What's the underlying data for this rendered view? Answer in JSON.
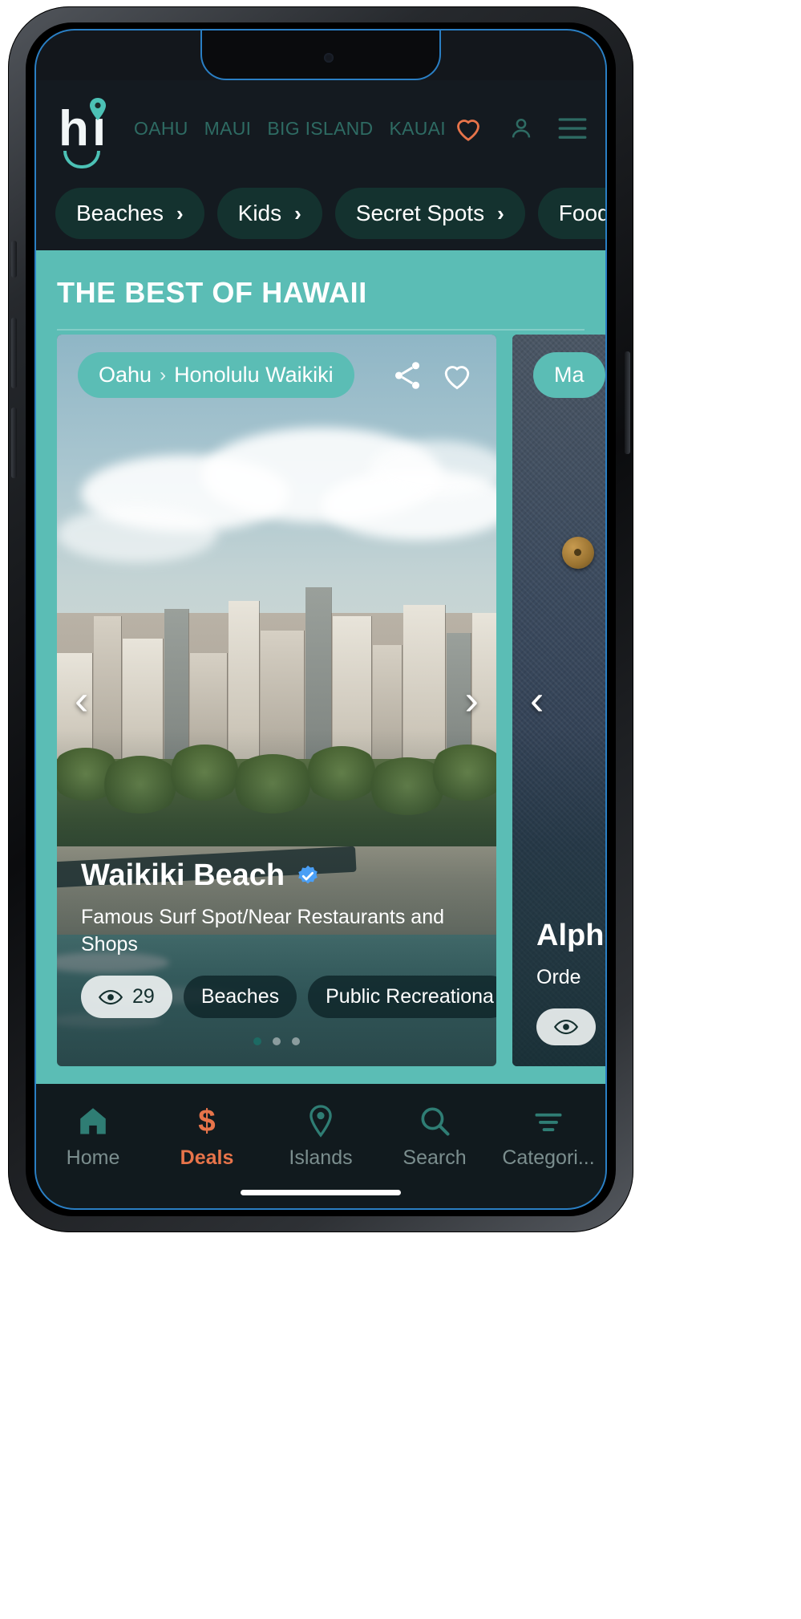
{
  "brand": {
    "logo_text_h": "h",
    "logo_text_i": "i",
    "pin_icon": "location-pin-icon",
    "accent_teal": "#5bbdb5",
    "accent_orange": "#e8744a",
    "header_bg": "#141a20"
  },
  "header": {
    "islands": [
      {
        "label": "OAHU"
      },
      {
        "label": "MAUI"
      },
      {
        "label": "BIG ISLAND"
      },
      {
        "label": "KAUAI"
      }
    ],
    "icons": [
      {
        "name": "heart-icon",
        "color": "#e8744a"
      },
      {
        "name": "user-icon",
        "color": "#2e6b63"
      },
      {
        "name": "hamburger-menu-icon",
        "color": "#2e6b63"
      }
    ]
  },
  "chips": [
    {
      "label": "Beaches",
      "arrow": "›"
    },
    {
      "label": "Kids",
      "arrow": "›"
    },
    {
      "label": "Secret Spots",
      "arrow": "›"
    },
    {
      "label": "Food",
      "arrow": "›"
    }
  ],
  "section": {
    "title": "THE BEST OF HAWAII"
  },
  "cards": [
    {
      "breadcrumb_island": "Oahu",
      "breadcrumb_sep": "›",
      "breadcrumb_place": "Honolulu Waikiki",
      "share_icon": "share-icon",
      "favorite_icon": "heart-outline-icon",
      "prev_arrow": "‹",
      "next_arrow": "›",
      "title": "Waikiki Beach",
      "verified_icon": "verified-badge-icon",
      "description": "Famous Surf Spot/Near Restaurants and Shops",
      "views_icon": "eye-icon",
      "views_count": "29",
      "tags": [
        "Beaches",
        "Public Recreationa"
      ],
      "dots": [
        "active",
        "inactive",
        "inactive"
      ]
    },
    {
      "breadcrumb_island": "Ma",
      "prev_arrow": "‹",
      "title": "Alph",
      "description": "Orde",
      "views_icon": "eye-icon"
    }
  ],
  "bottom_nav": [
    {
      "label": "Home",
      "icon": "home-icon",
      "active": false
    },
    {
      "label": "Deals",
      "icon": "dollar-icon",
      "active": true
    },
    {
      "label": "Islands",
      "icon": "map-pin-icon",
      "active": false
    },
    {
      "label": "Search",
      "icon": "search-icon",
      "active": false
    },
    {
      "label": "Categori...",
      "icon": "filter-icon",
      "active": false
    }
  ]
}
